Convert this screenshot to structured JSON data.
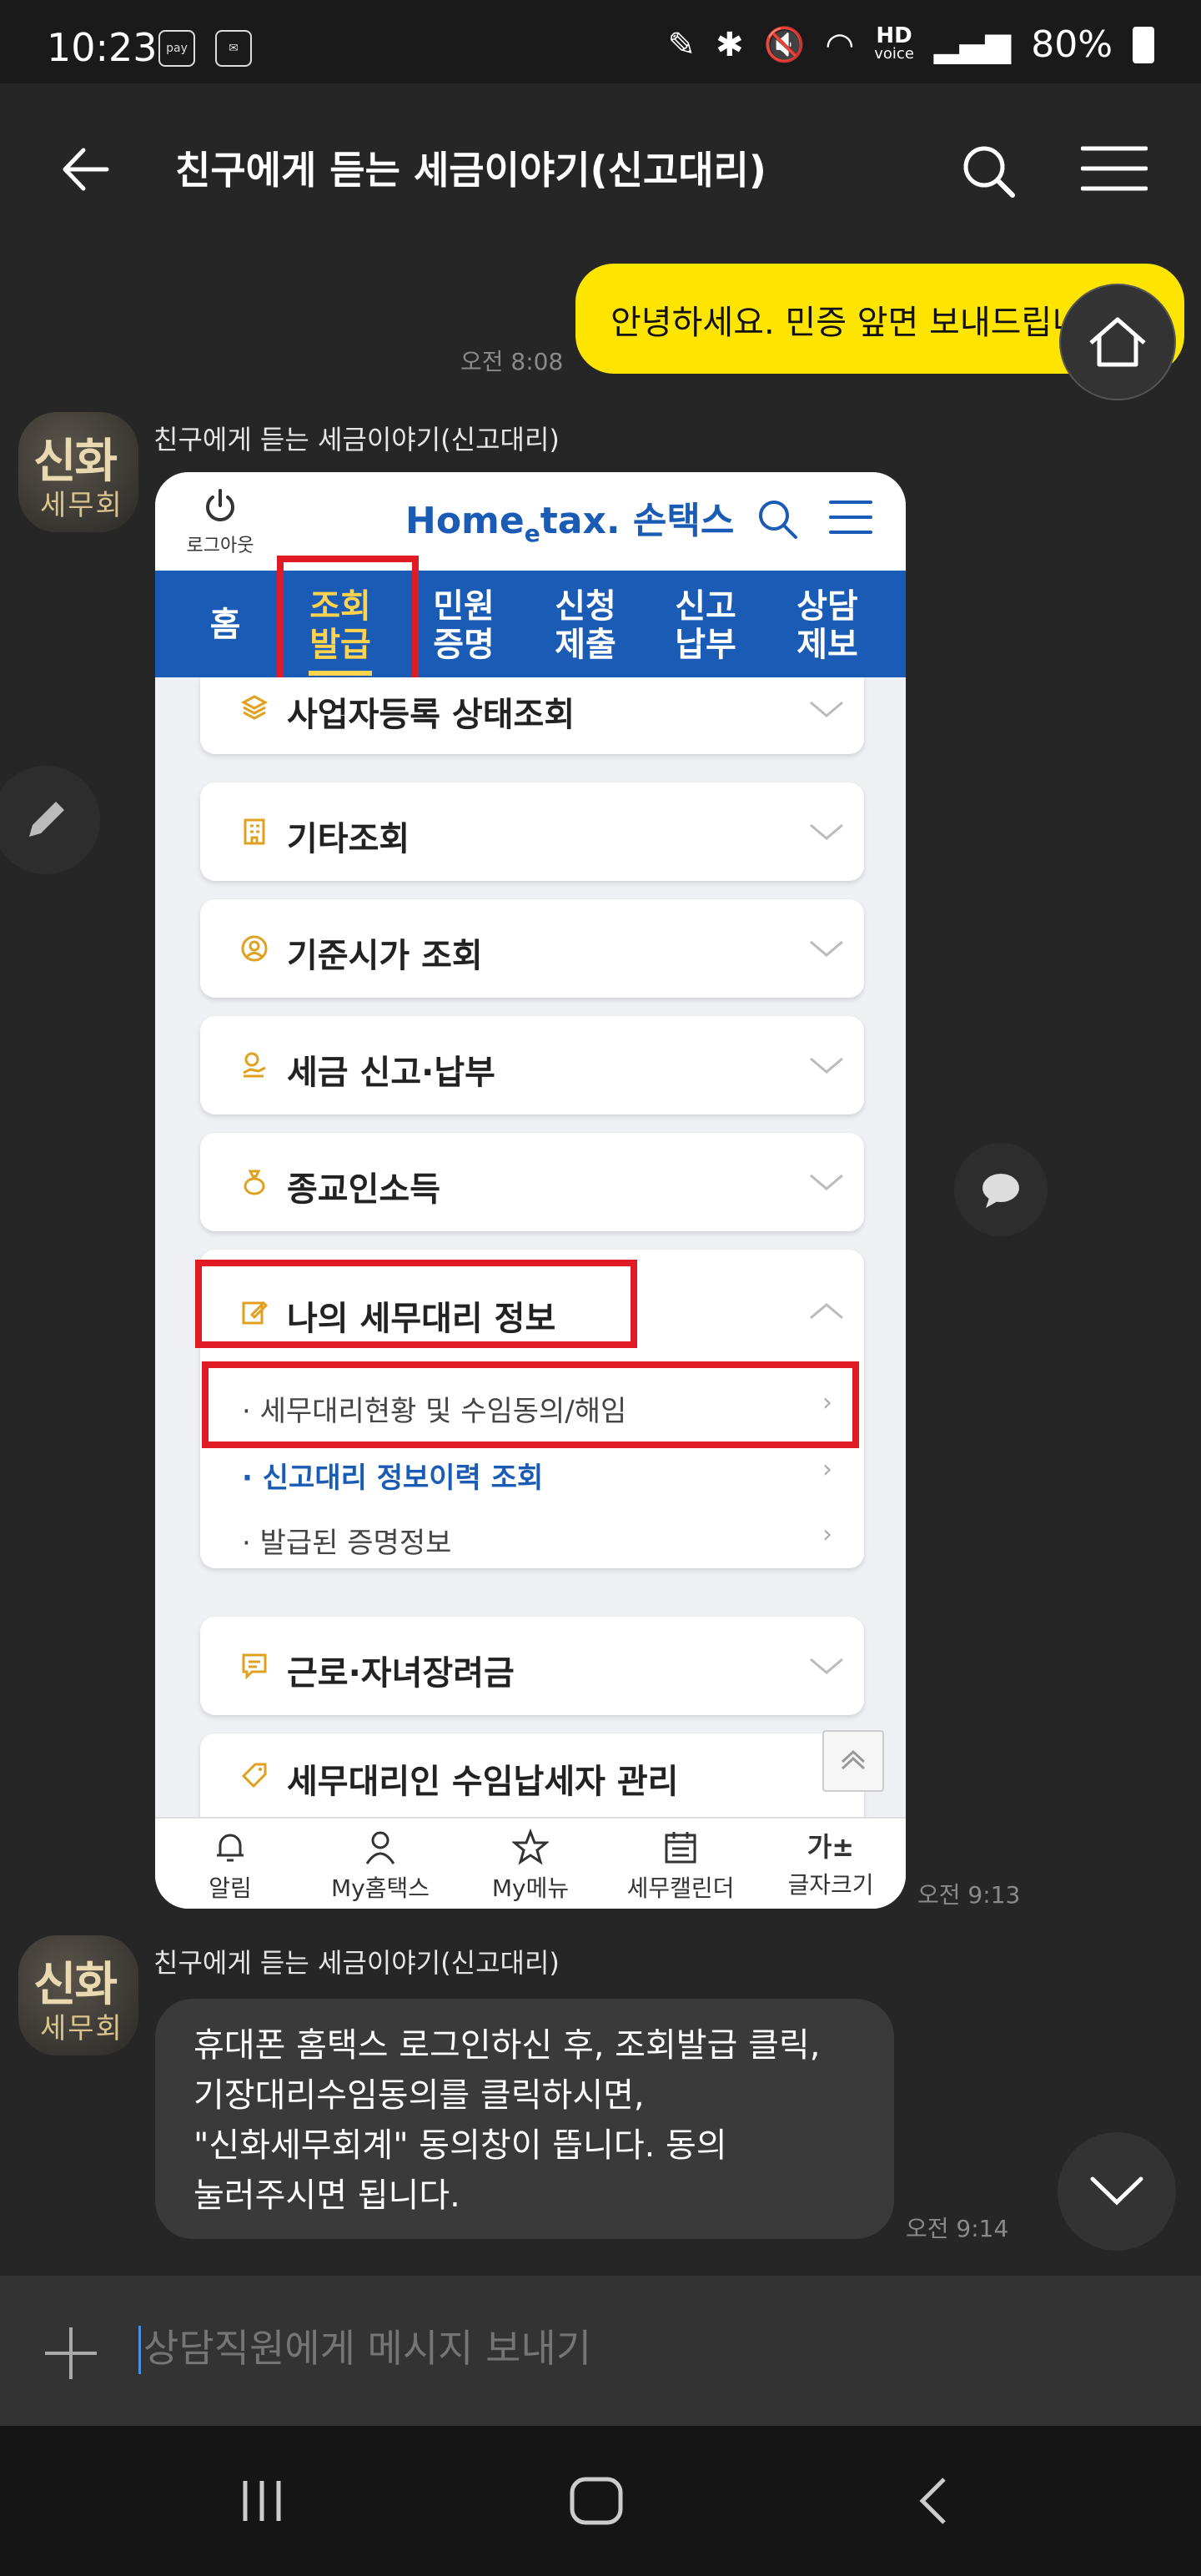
{
  "status_bar": {
    "time": "10:23",
    "left_icons": [
      "pay-icon",
      "mail-icon"
    ],
    "hd_label": "HD",
    "voice_label": "voice",
    "battery": "80%"
  },
  "header": {
    "title": "친구에게 듣는 세금이야기(신고대리)"
  },
  "messages": {
    "outgoing": {
      "text": "안녕하세요. 민증 앞면 보내드립니다.",
      "time": "오전 8:08"
    },
    "incoming_image": {
      "sender": "친구에게 듣는 세금이야기(신고대리)",
      "time": "오전 9:13"
    },
    "incoming_text": {
      "sender": "친구에게 듣는 세금이야기(신고대리)",
      "lines": [
        "휴대폰 홈택스 로그인하신 후, 조회발급 클릭,",
        "기장대리수임동의를 클릭하시면,",
        "\"신화세무회계\" 동의창이 뜹니다. 동의",
        "눌러주시면 됩니다."
      ],
      "time": "오전 9:14"
    }
  },
  "avatar": {
    "line1": "신화",
    "line2": "세무회"
  },
  "screenshot": {
    "logout_label": "로그아웃",
    "logo_main": "Home",
    "logo_e": "e",
    "logo_tax": "tax.",
    "logo_sub": " 손택스",
    "nav_tabs": [
      {
        "line1": "홈",
        "line2": ""
      },
      {
        "line1": "조회",
        "line2": "발급"
      },
      {
        "line1": "민원",
        "line2": "증명"
      },
      {
        "line1": "신청",
        "line2": "제출"
      },
      {
        "line1": "신고",
        "line2": "납부"
      },
      {
        "line1": "상담",
        "line2": "제보"
      }
    ],
    "menu_items": [
      "사업자등록 상태조회",
      "기타조회",
      "기준시가 조회",
      "세금 신고·납부",
      "종교인소득",
      "나의 세무대리 정보",
      "근로·자녀장려금",
      "세무대리인 수임납세자 관리"
    ],
    "sub_items": [
      "· 세무대리현황 및 수임동의/해임",
      "· 신고대리 정보이력 조회",
      "· 발급된 증명정보"
    ],
    "bottom_tabs": [
      "알림",
      "My홈택스",
      "My메뉴",
      "세무캘린더",
      "글자크기"
    ],
    "font_size_icon_text": "가±"
  },
  "input": {
    "placeholder": "상담직원에게 메시지 보내기"
  },
  "colors": {
    "my_bubble": "#fee500",
    "incoming_bubble": "#3a3a3a",
    "hometax_blue": "#1a5bb5",
    "highlight_red": "#e01b24"
  }
}
